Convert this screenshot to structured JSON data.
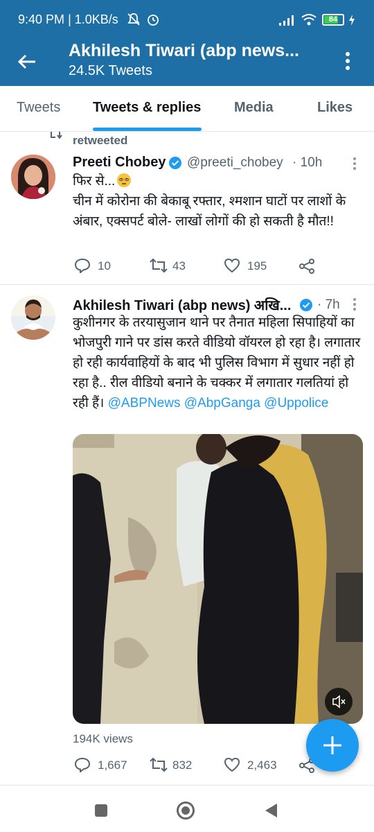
{
  "status_bar": {
    "time": "9:40 PM",
    "speed": "1.0KB/s",
    "battery": "84"
  },
  "header": {
    "title": "Akhilesh Tiwari (abp news...",
    "subtitle": "24.5K Tweets"
  },
  "tabs": [
    {
      "label": "Tweets"
    },
    {
      "label": "Tweets & replies"
    },
    {
      "label": "Media"
    },
    {
      "label": "Likes"
    }
  ],
  "tweets": [
    {
      "context": "retweeted",
      "name": "Preeti Chobey",
      "handle": "@preeti_chobey",
      "time": "· 10h",
      "text_line1": "फिर से...",
      "text_line2": "चीन में कोरोना की बेकाबू रफ्तार, श्मशान घाटों पर लाशों के अंबार, एक्सपर्ट बोले- लाखों लोगों की हो सकती है मौत!!",
      "replies": "10",
      "retweets": "43",
      "likes": "195"
    },
    {
      "name": "Akhilesh Tiwari (abp news) अखि...",
      "time": "· 7h",
      "text": "कुशीनगर के तरयासुजान थाने पर तैनात महिला सिपाहियों का भोजपुरी गाने पर डांस करते वीडियो वॉयरल हो रहा है। लगातार हो रही कार्यवाहियों के बाद भी पुलिस विभाग में सुधार नहीं हो रहा है.. रील वीडियो बनाने के चक्कर में लगातार गलतियां हो रही हैं।",
      "mention1": "@ABPNews",
      "mention2": "@AbpGanga",
      "mention3": "@Uppolice",
      "views": "194K views",
      "replies": "1,667",
      "retweets": "832",
      "likes": "2,463"
    }
  ],
  "colors": {
    "header_bg": "#1d6fa5",
    "accent": "#1d9bf0",
    "verified": "#1d9bf0"
  }
}
